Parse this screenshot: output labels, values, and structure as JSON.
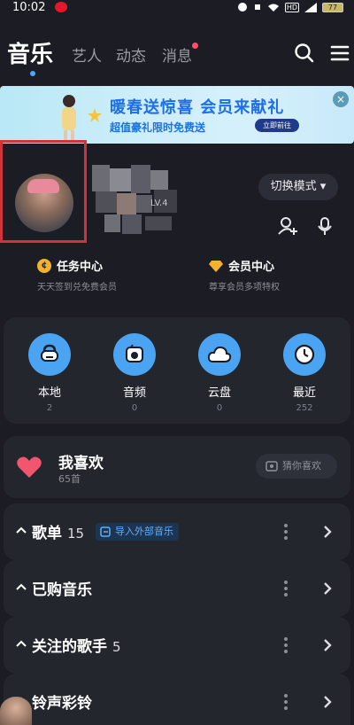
{
  "status_bar": {
    "time": "10:02",
    "network": "HD",
    "battery": "77"
  },
  "nav": {
    "tabs": [
      {
        "label": "音乐",
        "active": true
      },
      {
        "label": "艺人",
        "active": false
      },
      {
        "label": "动态",
        "active": false
      },
      {
        "label": "消息",
        "active": false,
        "badge": true
      }
    ],
    "search_icon": "search-icon",
    "menu_icon": "menu-icon"
  },
  "banner": {
    "title": "暖春送惊喜 会员来献礼",
    "subtitle": "超值豪礼限时免费送",
    "cta": "立即前往",
    "close_icon": "close-icon"
  },
  "profile": {
    "level": "LV.4",
    "mode_button": "切换模式 ▾",
    "add_friend_icon": "add-user-icon",
    "voice_icon": "mic-icon"
  },
  "quick_links": [
    {
      "title": "任务中心",
      "subtitle": "天天签到兑免费会员",
      "icon": "coin-icon"
    },
    {
      "title": "会员中心",
      "subtitle": "尊享会员多项特权",
      "icon": "diamond-icon"
    }
  ],
  "library": [
    {
      "label": "本地",
      "count": "2",
      "icon": "local-music-icon"
    },
    {
      "label": "音频",
      "count": "0",
      "icon": "audio-icon"
    },
    {
      "label": "云盘",
      "count": "0",
      "icon": "cloud-icon"
    },
    {
      "label": "最近",
      "count": "252",
      "icon": "clock-icon"
    }
  ],
  "favorites": {
    "title": "我喜欢",
    "count": "65首",
    "guess_button": "猜你喜欢"
  },
  "sections": [
    {
      "label": "歌单",
      "count": "15",
      "extra_button": "导入外部音乐"
    },
    {
      "label": "已购音乐",
      "count": ""
    },
    {
      "label": "关注的歌手",
      "count": "5"
    },
    {
      "label": "铃声彩铃",
      "count": ""
    }
  ],
  "colors": {
    "background": "#1c1d24",
    "card": "#24262e",
    "accent_blue": "#4aa4f2",
    "heart": "#f0566e",
    "highlight_border": "#d2323a"
  }
}
